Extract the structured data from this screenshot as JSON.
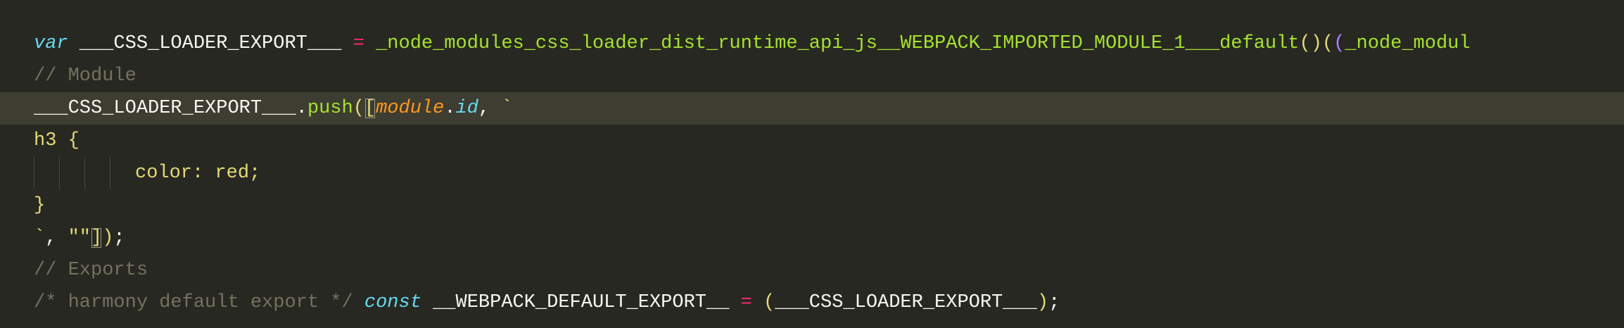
{
  "editor": {
    "lines": {
      "l1": {
        "kw": "var",
        "name": " ___CSS_LOADER_EXPORT___ ",
        "op": "=",
        "fn": " _node_modules_css_loader_dist_runtime_api_js__WEBPACK_IMPORTED_MODULE_1___default",
        "paren": "()",
        "paren2": "(",
        "paren3": "(",
        "rest": "_node_modul"
      },
      "l2": {
        "comment": "// Module"
      },
      "l3": {
        "obj": "___CSS_LOADER_EXPORT___",
        "dot": ".",
        "method": "push",
        "paren": "(",
        "bracket": "[",
        "module": "module",
        "dot2": ".",
        "id": "id",
        "comma": ", ",
        "tick": "`"
      },
      "l4": {
        "selector": "h3 {"
      },
      "l5": {
        "decl": "color: red;"
      },
      "l6": {
        "close": "}"
      },
      "l7": {
        "tick": "`",
        "comma": ", ",
        "str": "\"\"",
        "bracket": "]",
        "paren": ")",
        "semi": ";"
      },
      "l8": {
        "comment": "// Exports"
      },
      "l9": {
        "comment": "/* harmony default export */",
        "kw": "const",
        "name": " __WEBPACK_DEFAULT_EXPORT__ ",
        "op": "=",
        "paren": "(",
        "inner": "___CSS_LOADER_EXPORT___",
        "paren2": ")",
        "semi": ";"
      }
    }
  },
  "colors": {
    "background": "#272822",
    "active_line": "#3e3d32",
    "keyword": "#66d9ef",
    "operator": "#f92672",
    "function": "#a6e22e",
    "string": "#e6db74",
    "comment": "#75715e",
    "parameter": "#fd971f",
    "plain": "#f8f8f2"
  }
}
